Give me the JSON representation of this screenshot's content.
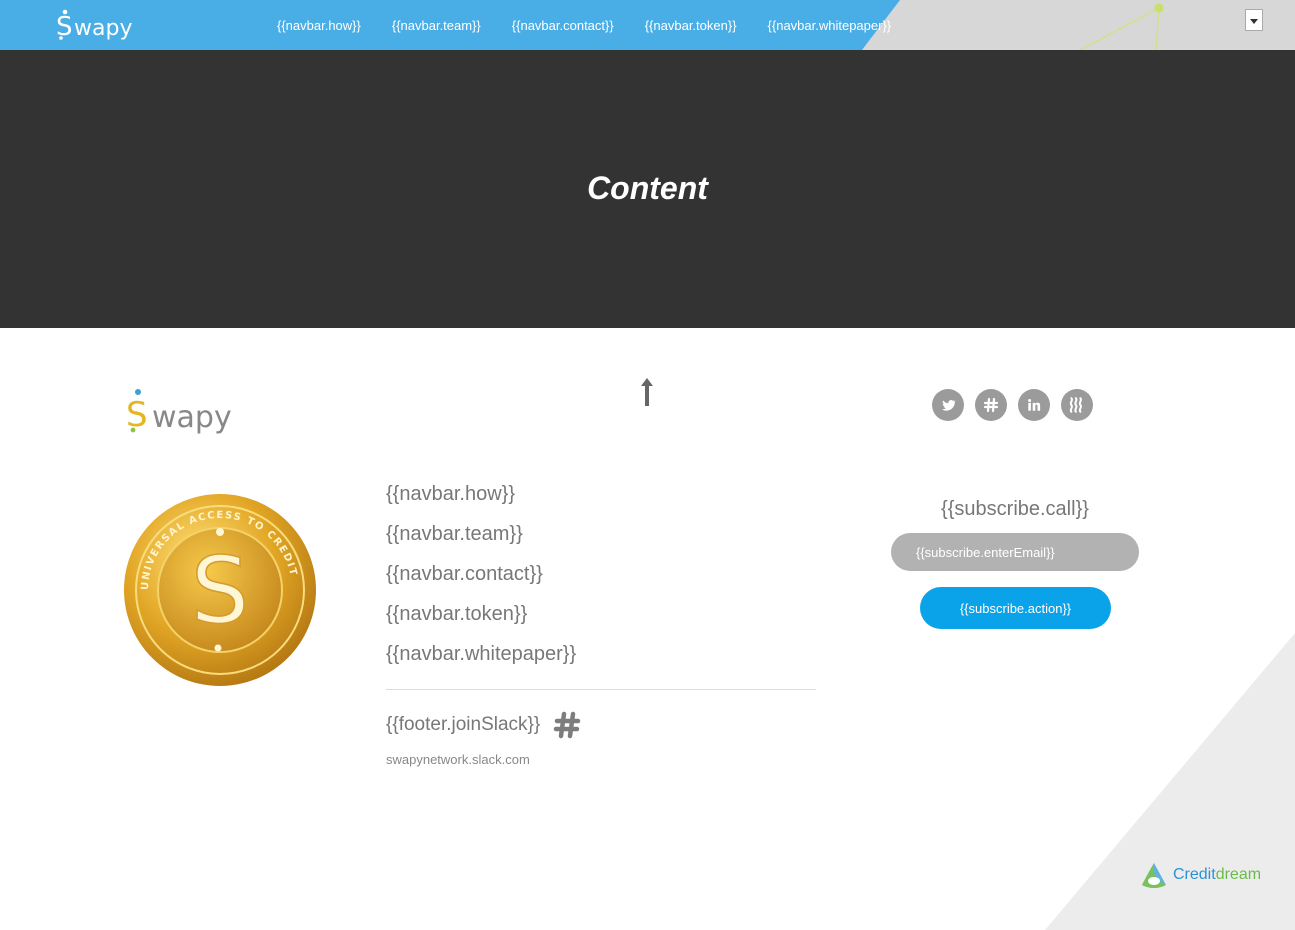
{
  "navbar": {
    "brand": "Swapy",
    "links": [
      "{{navbar.how}}",
      "{{navbar.team}}",
      "{{navbar.contact}}",
      "{{navbar.token}}",
      "{{navbar.whitepaper}}"
    ],
    "language_selected": ""
  },
  "hero": {
    "title": "Content"
  },
  "footer": {
    "brand": "Swapy",
    "social": [
      "twitter-icon",
      "slack-icon",
      "linkedin-icon",
      "steemit-icon"
    ],
    "links": [
      "{{navbar.how}}",
      "{{navbar.team}}",
      "{{navbar.contact}}",
      "{{navbar.token}}",
      "{{navbar.whitepaper}}"
    ],
    "join_slack": "{{footer.joinSlack}}",
    "slack_url": "swapynetwork.slack.com",
    "coin_text": "UNIVERSAL ACCESS TO CREDIT"
  },
  "subscribe": {
    "call": "{{subscribe.call}}",
    "placeholder": "{{subscribe.enterEmail}}",
    "action": "{{subscribe.action}}"
  },
  "creditdream": {
    "name_a": "Credit",
    "name_b": "dream"
  },
  "colors": {
    "navbar": "#4aaee6",
    "hero": "#333333",
    "accent_button": "#0aa2e8",
    "muted_text": "#777777"
  }
}
